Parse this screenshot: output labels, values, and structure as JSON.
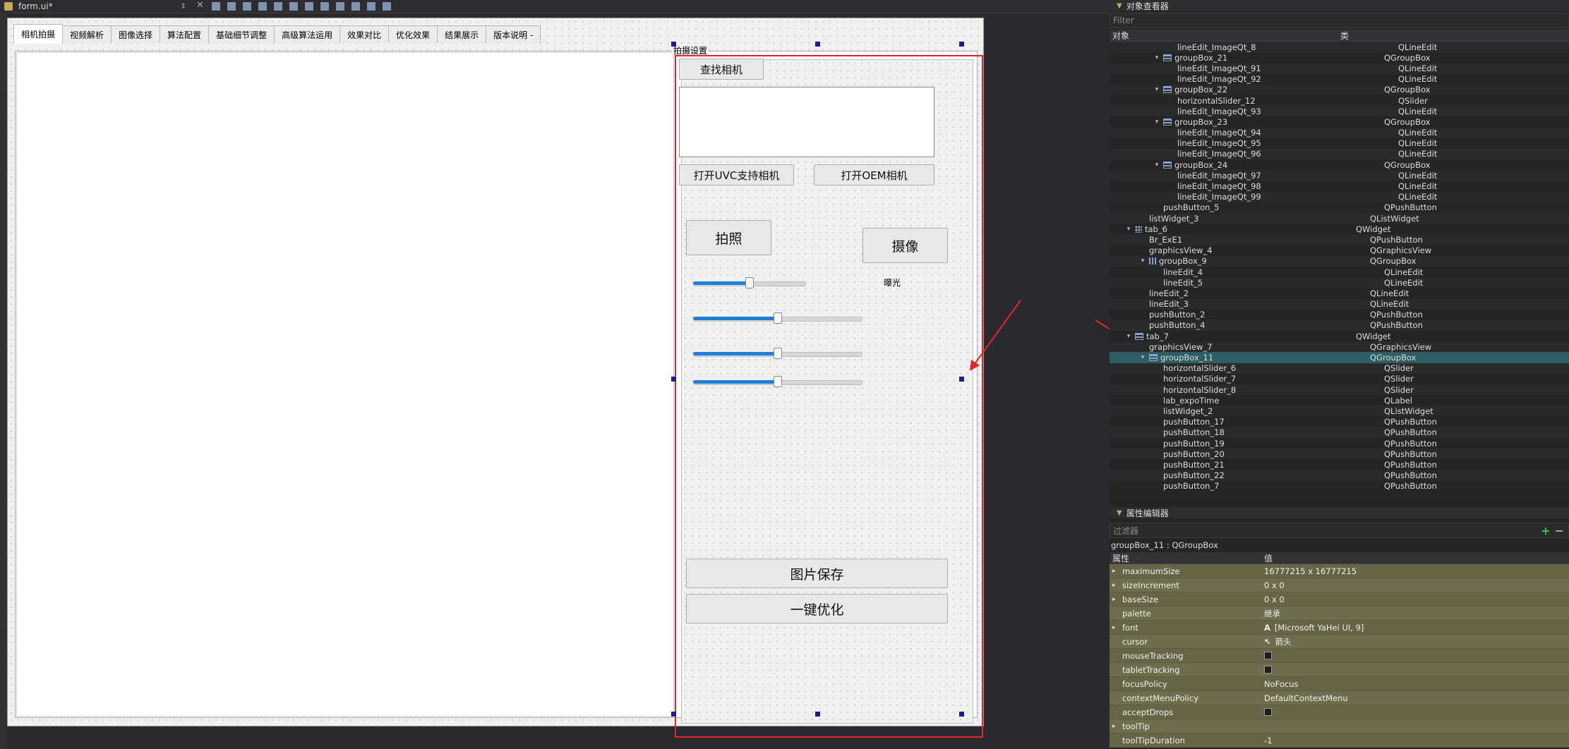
{
  "toolbar": {
    "file_name": "form.ui*",
    "close_glyph": "✕"
  },
  "form": {
    "tabs": [
      "相机拍摄",
      "视频解析",
      "图像选择",
      "算法配置",
      "基础细节调整",
      "高级算法运用",
      "效果对比",
      "优化效果",
      "结果展示",
      "版本说明 -"
    ],
    "active_tab": 0,
    "group_title": "拍摄设置",
    "find_camera": "查找相机",
    "open_uvc": "打开UVC支持相机",
    "open_oem": "打开OEM相机",
    "photo": "拍照",
    "video": "摄像",
    "exposure_label": "曝光",
    "sliders": [
      0.5,
      0.5,
      0.5,
      0.5
    ],
    "save_image": "图片保存",
    "one_click_optimize": "一键优化"
  },
  "object_inspector": {
    "title": "对象查看器",
    "filter_placeholder": "Filter",
    "col_object": "对象",
    "col_class": "类",
    "rows": [
      {
        "indent": 4,
        "icon": "",
        "exp": "",
        "name": "lineEdit_ImageQt_8",
        "cls": "QLineEdit"
      },
      {
        "indent": 3,
        "icon": "group",
        "exp": "▾",
        "name": "groupBox_21",
        "cls": "QGroupBox"
      },
      {
        "indent": 4,
        "icon": "",
        "exp": "",
        "name": "lineEdit_ImageQt_91",
        "cls": "QLineEdit"
      },
      {
        "indent": 4,
        "icon": "",
        "exp": "",
        "name": "lineEdit_ImageQt_92",
        "cls": "QLineEdit"
      },
      {
        "indent": 3,
        "icon": "group",
        "exp": "▾",
        "name": "groupBox_22",
        "cls": "QGroupBox"
      },
      {
        "indent": 4,
        "icon": "",
        "exp": "",
        "name": "horizontalSlider_12",
        "cls": "QSlider"
      },
      {
        "indent": 4,
        "icon": "",
        "exp": "",
        "name": "lineEdit_ImageQt_93",
        "cls": "QLineEdit"
      },
      {
        "indent": 3,
        "icon": "group",
        "exp": "▾",
        "name": "groupBox_23",
        "cls": "QGroupBox"
      },
      {
        "indent": 4,
        "icon": "",
        "exp": "",
        "name": "lineEdit_ImageQt_94",
        "cls": "QLineEdit"
      },
      {
        "indent": 4,
        "icon": "",
        "exp": "",
        "name": "lineEdit_ImageQt_95",
        "cls": "QLineEdit"
      },
      {
        "indent": 4,
        "icon": "",
        "exp": "",
        "name": "lineEdit_ImageQt_96",
        "cls": "QLineEdit"
      },
      {
        "indent": 3,
        "icon": "group",
        "exp": "▾",
        "name": "groupBox_24",
        "cls": "QGroupBox"
      },
      {
        "indent": 4,
        "icon": "",
        "exp": "",
        "name": "lineEdit_ImageQt_97",
        "cls": "QLineEdit"
      },
      {
        "indent": 4,
        "icon": "",
        "exp": "",
        "name": "lineEdit_ImageQt_98",
        "cls": "QLineEdit"
      },
      {
        "indent": 4,
        "icon": "",
        "exp": "",
        "name": "lineEdit_ImageQt_99",
        "cls": "QLineEdit"
      },
      {
        "indent": 3,
        "icon": "",
        "exp": "",
        "name": "pushButton_5",
        "cls": "QPushButton"
      },
      {
        "indent": 2,
        "icon": "",
        "exp": "",
        "name": "listWidget_3",
        "cls": "QListWidget"
      },
      {
        "indent": 1,
        "icon": "grid",
        "exp": "▾",
        "name": "tab_6",
        "cls": "QWidget"
      },
      {
        "indent": 2,
        "icon": "",
        "exp": "",
        "name": "Br_ExE1",
        "cls": "QPushButton"
      },
      {
        "indent": 2,
        "icon": "",
        "exp": "",
        "name": "graphicsView_4",
        "cls": "QGraphicsView"
      },
      {
        "indent": 2,
        "icon": "vbox",
        "exp": "▾",
        "name": "groupBox_9",
        "cls": "QGroupBox"
      },
      {
        "indent": 3,
        "icon": "",
        "exp": "",
        "name": "lineEdit_4",
        "cls": "QLineEdit"
      },
      {
        "indent": 3,
        "icon": "",
        "exp": "",
        "name": "lineEdit_5",
        "cls": "QLineEdit"
      },
      {
        "indent": 2,
        "icon": "",
        "exp": "",
        "name": "lineEdit_2",
        "cls": "QLineEdit"
      },
      {
        "indent": 2,
        "icon": "",
        "exp": "",
        "name": "lineEdit_3",
        "cls": "QLineEdit"
      },
      {
        "indent": 2,
        "icon": "",
        "exp": "",
        "name": "pushButton_2",
        "cls": "QPushButton"
      },
      {
        "indent": 2,
        "icon": "",
        "exp": "",
        "name": "pushButton_4",
        "cls": "QPushButton"
      },
      {
        "indent": 1,
        "icon": "group",
        "exp": "▾",
        "name": "tab_7",
        "cls": "QWidget"
      },
      {
        "indent": 2,
        "icon": "",
        "exp": "",
        "name": "graphicsView_7",
        "cls": "QGraphicsView"
      },
      {
        "indent": 2,
        "icon": "group",
        "exp": "▾",
        "name": "groupBox_11",
        "cls": "QGroupBox",
        "selected": true
      },
      {
        "indent": 3,
        "icon": "",
        "exp": "",
        "name": "horizontalSlider_6",
        "cls": "QSlider"
      },
      {
        "indent": 3,
        "icon": "",
        "exp": "",
        "name": "horizontalSlider_7",
        "cls": "QSlider"
      },
      {
        "indent": 3,
        "icon": "",
        "exp": "",
        "name": "horizontalSlider_8",
        "cls": "QSlider"
      },
      {
        "indent": 3,
        "icon": "",
        "exp": "",
        "name": "lab_expoTime",
        "cls": "QLabel"
      },
      {
        "indent": 3,
        "icon": "",
        "exp": "",
        "name": "listWidget_2",
        "cls": "QListWidget"
      },
      {
        "indent": 3,
        "icon": "",
        "exp": "",
        "name": "pushButton_17",
        "cls": "QPushButton"
      },
      {
        "indent": 3,
        "icon": "",
        "exp": "",
        "name": "pushButton_18",
        "cls": "QPushButton"
      },
      {
        "indent": 3,
        "icon": "",
        "exp": "",
        "name": "pushButton_19",
        "cls": "QPushButton"
      },
      {
        "indent": 3,
        "icon": "",
        "exp": "",
        "name": "pushButton_20",
        "cls": "QPushButton"
      },
      {
        "indent": 3,
        "icon": "",
        "exp": "",
        "name": "pushButton_21",
        "cls": "QPushButton"
      },
      {
        "indent": 3,
        "icon": "",
        "exp": "",
        "name": "pushButton_22",
        "cls": "QPushButton"
      },
      {
        "indent": 3,
        "icon": "",
        "exp": "",
        "name": "pushButton_7",
        "cls": "QPushButton"
      }
    ]
  },
  "property_editor": {
    "title": "属性编辑器",
    "filter_placeholder": "过滤器",
    "object_line": "groupBox_11 : QGroupBox",
    "col_property": "属性",
    "col_value": "值",
    "rows": [
      {
        "exp": "▸",
        "name": "maximumSize",
        "value": "16777215 x 16777215",
        "kind": "text"
      },
      {
        "exp": "▸",
        "name": "sizeIncrement",
        "value": "0 x 0",
        "kind": "text"
      },
      {
        "exp": "▸",
        "name": "baseSize",
        "value": "0 x 0",
        "kind": "text"
      },
      {
        "exp": "",
        "name": "palette",
        "value": "继承",
        "kind": "text"
      },
      {
        "exp": "▸",
        "name": "font",
        "value": "[Microsoft YaHei UI, 9]",
        "kind": "font"
      },
      {
        "exp": "",
        "name": "cursor",
        "value": "箭头",
        "kind": "cursor"
      },
      {
        "exp": "",
        "name": "mouseTracking",
        "value": "",
        "kind": "check"
      },
      {
        "exp": "",
        "name": "tabletTracking",
        "value": "",
        "kind": "check"
      },
      {
        "exp": "",
        "name": "focusPolicy",
        "value": "NoFocus",
        "kind": "text"
      },
      {
        "exp": "",
        "name": "contextMenuPolicy",
        "value": "DefaultContextMenu",
        "kind": "text"
      },
      {
        "exp": "",
        "name": "acceptDrops",
        "value": "",
        "kind": "check"
      },
      {
        "exp": "▸",
        "name": "toolTip",
        "value": "",
        "kind": "text"
      },
      {
        "exp": "",
        "name": "toolTipDuration",
        "value": "-1",
        "kind": "text"
      }
    ]
  }
}
